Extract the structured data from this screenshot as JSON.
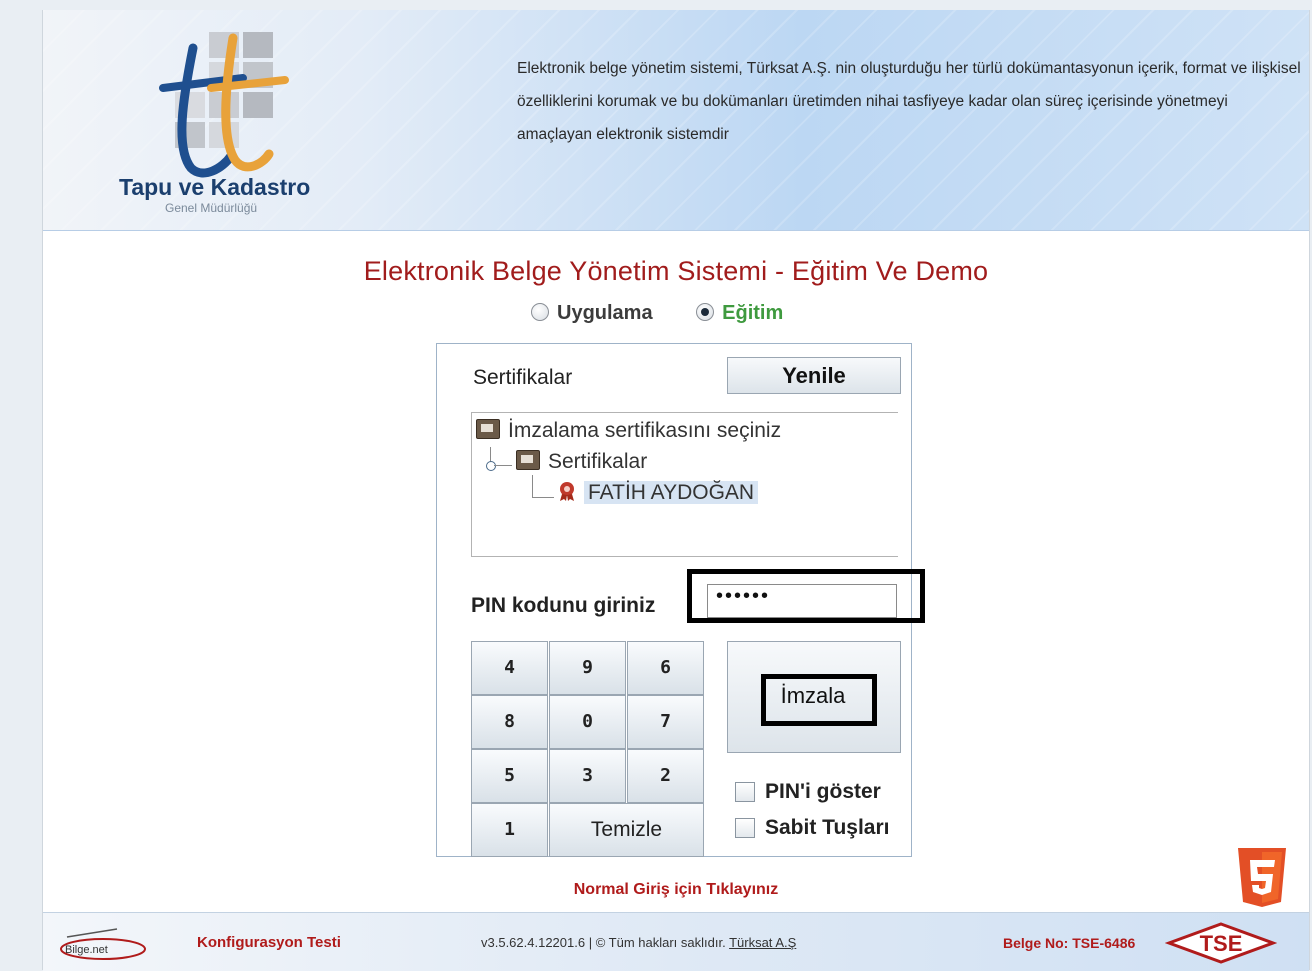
{
  "header": {
    "org_name": "Tapu ve Kadastro",
    "org_subtitle": "Genel Müdürlüğü",
    "description": "Elektronik belge yönetim sistemi, Türksat A.Ş. nin oluşturduğu her türlü dokümantasyonun içerik, format ve ilişkisel özelliklerini korumak ve bu dokümanları üretimden nihai tasfiyeye kadar olan süreç içerisinde yönetmeyi amaçlayan elektronik sistemdir"
  },
  "page_title": "Elektronik Belge Yönetim Sistemi - Eğitim Ve Demo",
  "mode": {
    "options": [
      {
        "label": "Uygulama",
        "selected": false
      },
      {
        "label": "Eğitim",
        "selected": true
      }
    ]
  },
  "applet": {
    "certificates_label": "Sertifikalar",
    "refresh_button": "Yenile",
    "tree": {
      "root_label": "İmzalama sertifikasını seçiniz",
      "folder_label": "Sertifikalar",
      "selected_cert": "FATİH AYDOĞAN"
    },
    "pin_label": "PIN kodunu giriniz",
    "pin_value": "••••••",
    "keypad": {
      "keys": [
        "4",
        "9",
        "6",
        "8",
        "0",
        "7",
        "5",
        "3",
        "2",
        "1"
      ],
      "clear": "Temizle"
    },
    "sign_button": "İmzala",
    "show_pin": {
      "label": "PIN'i göster",
      "checked": false
    },
    "fixed_keys": {
      "label": "Sabit Tuşları",
      "checked": false
    }
  },
  "normal_login_link": "Normal Giriş için Tıklayınız",
  "footer": {
    "config_test": "Konfigurasyon Testi",
    "version": "v3.5.62.4.12201.6 | © Tüm hakları saklıdır.",
    "vendor_link": "Türksat A.Ş",
    "belge_no": "Belge No: TSE-6486"
  },
  "colors": {
    "accent_red": "#a11c1c",
    "selected_green": "#3f9a3f",
    "header_blue": "#bcd7f3"
  },
  "icons": [
    "tkgm-logo",
    "radio-icon",
    "folder-icon",
    "certificate-icon",
    "checkbox-icon",
    "html5-icon",
    "bilgenet-logo",
    "tse-logo"
  ]
}
